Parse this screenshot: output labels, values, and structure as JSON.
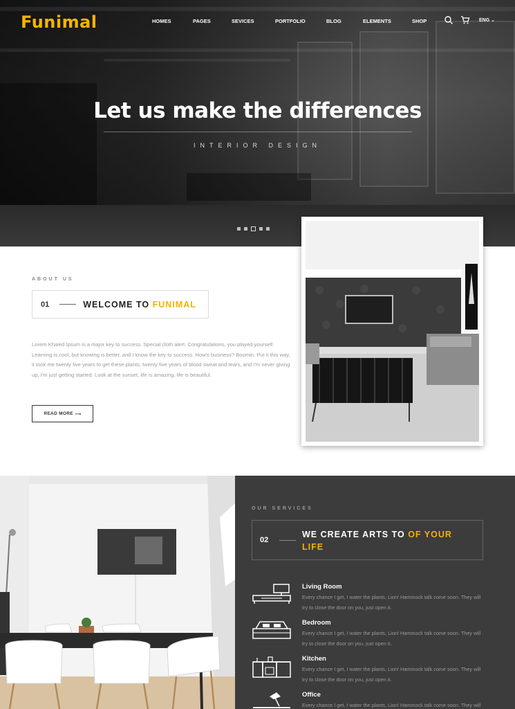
{
  "brand": {
    "logo": "Funimal",
    "accent_color": "#f4b400"
  },
  "nav": {
    "items": [
      "HOMES",
      "PAGES",
      "SEVICES",
      "PORTFOLIO",
      "BLOG",
      "ELEMENTS",
      "SHOP"
    ],
    "search_icon": "search-icon",
    "cart_icon": "cart-icon",
    "language": "ENG"
  },
  "hero": {
    "title": "Let us make the differences",
    "subtitle": "INTERIOR DESIGN",
    "slides": 5,
    "active_slide": 3
  },
  "about": {
    "label": "ABOUT US",
    "number": "01",
    "heading": "WELCOME TO",
    "heading_accent": "FUNIMAL",
    "paragraph": "Lorem Khaled Ipsum is a major key to success. Special cloth alert. Congratulations, you played yourself. Learning is cool, but knowing is better, and I know the key to success. How's business? Boomin. Put it this way, it took me twenty five years to get these plants, twenty five years of blood sweat and tears, and I'm never giving up, I'm just getting started. Look at the sunset, life is amazing, life is beautiful.",
    "button": "READ MORE"
  },
  "services": {
    "label": "OUR SERVICES",
    "number": "02",
    "heading": "WE CREATE ARTS TO",
    "heading_accent": "OF YOUR LIFE",
    "items": [
      {
        "name": "Living Room",
        "icon": "sofa-icon",
        "desc": "Every chance I get, I water the plants, Lion! Hammock talk come soon. They will try to close the door on you, just open it."
      },
      {
        "name": "Bedroom",
        "icon": "bed-icon",
        "desc": "Every chance I get, I water the plants, Lion! Hammock talk come soon. They will try to close the door on you, just open it."
      },
      {
        "name": "Kitchen",
        "icon": "kitchen-icon",
        "desc": "Every chance I get, I water the plants, Lion! Hammock talk come soon. They will try to close the door on you, just open it."
      },
      {
        "name": "Office",
        "icon": "desk-lamp-icon",
        "desc": "Every chance I get, I water the plants, Lion! Hammock talk come soon. They will try to close the door on you, just open it."
      }
    ]
  }
}
